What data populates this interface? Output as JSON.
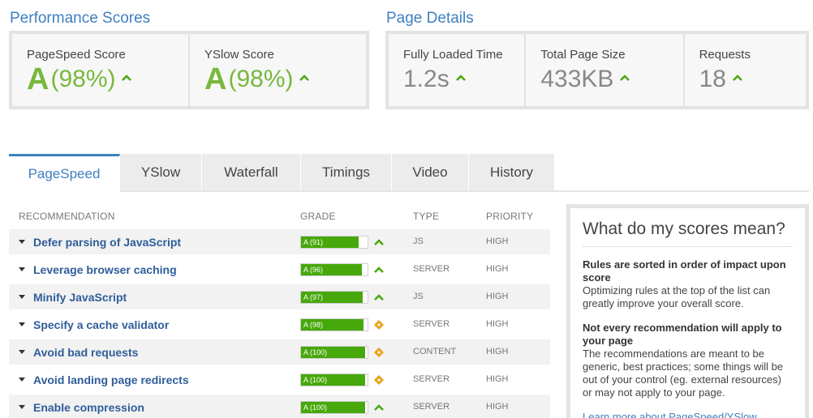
{
  "performance": {
    "title": "Performance Scores",
    "pagespeed_label": "PageSpeed Score",
    "pagespeed_grade": "A",
    "pagespeed_pct": "(98%)",
    "yslow_label": "YSlow Score",
    "yslow_grade": "A",
    "yslow_pct": "(98%)"
  },
  "details": {
    "title": "Page Details",
    "load_label": "Fully Loaded Time",
    "load_value": "1.2s",
    "size_label": "Total Page Size",
    "size_value": "433KB",
    "req_label": "Requests",
    "req_value": "18"
  },
  "tabs": [
    "PageSpeed",
    "YSlow",
    "Waterfall",
    "Timings",
    "Video",
    "History"
  ],
  "table": {
    "headers": {
      "recommendation": "RECOMMENDATION",
      "grade": "GRADE",
      "type": "TYPE",
      "priority": "PRIORITY"
    },
    "rows": [
      {
        "name": "Defer parsing of JavaScript",
        "grade": "A (91)",
        "score": 91,
        "trend": "up",
        "type": "JS",
        "priority": "HIGH"
      },
      {
        "name": "Leverage browser caching",
        "grade": "A (96)",
        "score": 96,
        "trend": "up",
        "type": "SERVER",
        "priority": "HIGH"
      },
      {
        "name": "Minify JavaScript",
        "grade": "A (97)",
        "score": 97,
        "trend": "up",
        "type": "JS",
        "priority": "HIGH"
      },
      {
        "name": "Specify a cache validator",
        "grade": "A (98)",
        "score": 98,
        "trend": "same",
        "type": "SERVER",
        "priority": "HIGH"
      },
      {
        "name": "Avoid bad requests",
        "grade": "A (100)",
        "score": 100,
        "trend": "same",
        "type": "CONTENT",
        "priority": "HIGH"
      },
      {
        "name": "Avoid landing page redirects",
        "grade": "A (100)",
        "score": 100,
        "trend": "same",
        "type": "SERVER",
        "priority": "HIGH"
      },
      {
        "name": "Enable compression",
        "grade": "A (100)",
        "score": 100,
        "trend": "up",
        "type": "SERVER",
        "priority": "HIGH"
      }
    ]
  },
  "side": {
    "title": "What do my scores mean?",
    "h1": "Rules are sorted in order of impact upon score",
    "p1": "Optimizing rules at the top of the list can greatly improve your overall score.",
    "h2": "Not every recommendation will apply to your page",
    "p2": "The recommendations are meant to be generic, best practices; some things will be out of your control (eg. external resources) or may not apply to your page.",
    "link": "Learn more about PageSpeed/YSlow"
  },
  "colors": {
    "accent": "#3f7fbf",
    "grade_green": "#78b83c",
    "bar_green": "#46a80a",
    "neutral_orange": "#e8a317"
  }
}
